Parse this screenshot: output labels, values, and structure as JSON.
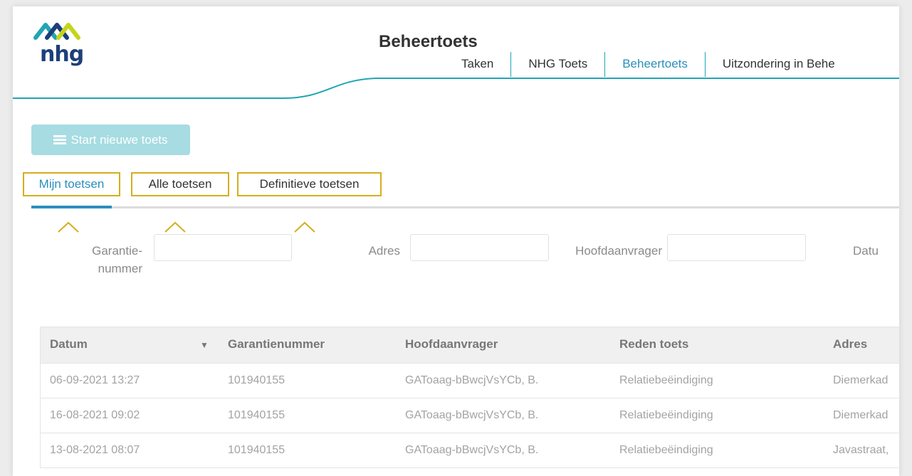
{
  "header": {
    "logo_text": "nhg",
    "page_title": "Beheertoets",
    "nav": [
      {
        "label": "Taken"
      },
      {
        "label": "NHG Toets"
      },
      {
        "label": "Beheertoets"
      },
      {
        "label": "Uitzondering in Behe"
      }
    ],
    "active_nav": "Beheertoets"
  },
  "toolbar": {
    "start_label": "Start nieuwe toets",
    "start_icon": "list-icon"
  },
  "tabs": [
    {
      "label": "Mijn toetsen"
    },
    {
      "label": "Alle toetsen"
    },
    {
      "label": "Definitieve toetsen"
    }
  ],
  "active_tab": "Mijn toetsen",
  "filters": {
    "garantie_label_1": "Garantie-",
    "garantie_label_2": "nummer",
    "adres_label": "Adres",
    "hoofdaanvrager_label": "Hoofdaanvrager",
    "datum_label": "Datu"
  },
  "table": {
    "columns": [
      "Datum",
      "Garantienummer",
      "Hoofdaanvrager",
      "Reden toets",
      "Adres"
    ],
    "sort_icon": "sort-down-icon",
    "rows": [
      [
        "06-09-2021 13:27",
        "101940155",
        "GAToaag-bBwcjVsYCb, B.",
        "Relatiebeëindiging",
        "Diemerkad"
      ],
      [
        "16-08-2021 09:02",
        "101940155",
        "GAToaag-bBwcjVsYCb, B.",
        "Relatiebeëindiging",
        "Diemerkad"
      ],
      [
        "13-08-2021 08:07",
        "101940155",
        "GAToaag-bBwcjVsYCb, B.",
        "Relatiebeëindiging",
        "Javastraat,"
      ]
    ]
  },
  "colors": {
    "accent": "#2a8fbd",
    "teal": "#21a5b5",
    "highlight": "#d4ae1e",
    "button_disabled": "#a6dce2"
  }
}
